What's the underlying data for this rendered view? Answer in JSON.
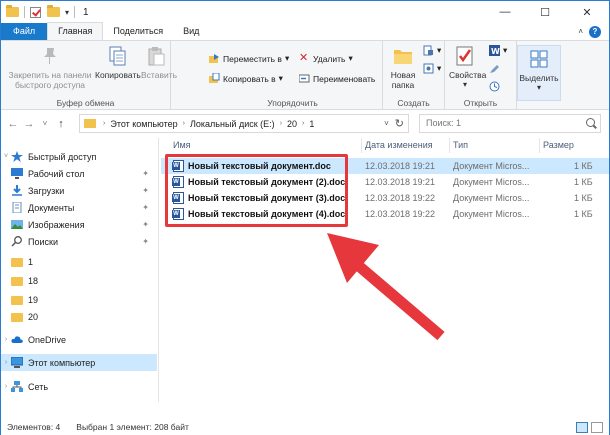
{
  "window": {
    "title": "1",
    "minimize_glyph": "—",
    "maximize_glyph": "☐",
    "close_glyph": "✕"
  },
  "tabs": [
    "Файл",
    "Главная",
    "Поделиться",
    "Вид"
  ],
  "ribbon": {
    "clipboard": {
      "group_label": "Буфер обмена",
      "pin_label": "Закрепить на панели быстрого доступа",
      "copy_label": "Копировать",
      "paste_label": "Вставить"
    },
    "organize": {
      "group_label": "Упорядочить",
      "move_to": "Переместить в",
      "copy_to": "Копировать в",
      "delete": "Удалить",
      "rename": "Переименовать"
    },
    "create": {
      "group_label": "Создать",
      "new_folder": "Новая папка"
    },
    "open": {
      "group_label": "Открыть",
      "properties": "Свойства"
    },
    "select": {
      "select_label": "Выделить"
    }
  },
  "address": {
    "crumbs": [
      "Этот компьютер",
      "Локальный диск (E:)",
      "20",
      "1"
    ],
    "search_placeholder": "Поиск: 1"
  },
  "nav": [
    {
      "label": "Быстрый доступ",
      "icon": "star-icon"
    },
    {
      "label": "Рабочий стол",
      "icon": "desktop-icon",
      "pinned": true
    },
    {
      "label": "Загрузки",
      "icon": "download-icon",
      "pinned": true
    },
    {
      "label": "Документы",
      "icon": "documents-icon",
      "pinned": true
    },
    {
      "label": "Изображения",
      "icon": "pictures-icon",
      "pinned": true
    },
    {
      "label": "Поиски",
      "icon": "search-icon",
      "pinned": true
    },
    {
      "label": "1",
      "icon": "folder-icon"
    },
    {
      "label": "18",
      "icon": "folder-icon"
    },
    {
      "label": "19",
      "icon": "folder-icon"
    },
    {
      "label": "20",
      "icon": "folder-icon"
    },
    {
      "label": "OneDrive",
      "icon": "cloud-icon"
    },
    {
      "label": "Этот компьютер",
      "icon": "computer-icon"
    },
    {
      "label": "Сеть",
      "icon": "network-icon"
    }
  ],
  "columns": {
    "name": "Имя",
    "date": "Дата изменения",
    "type": "Тип",
    "size": "Размер"
  },
  "files": [
    {
      "name": "Новый текстовый документ.doc",
      "date": "12.03.2018 19:21",
      "type": "Документ Micros...",
      "size": "1 КБ"
    },
    {
      "name": "Новый текстовый документ (2).doc",
      "date": "12.03.2018 19:21",
      "type": "Документ Micros...",
      "size": "1 КБ"
    },
    {
      "name": "Новый текстовый документ (3).doc",
      "date": "12.03.2018 19:22",
      "type": "Документ Micros...",
      "size": "1 КБ"
    },
    {
      "name": "Новый текстовый документ (4).doc",
      "date": "12.03.2018 19:22",
      "type": "Документ Micros...",
      "size": "1 КБ"
    }
  ],
  "status": {
    "items": "Элементов: 4",
    "selected": "Выбран 1 элемент: 208 байт"
  },
  "colors": {
    "accent": "#1979ca",
    "selection": "#cce8ff",
    "annotation_red": "#e6373d",
    "folder": "#f2c24e"
  }
}
